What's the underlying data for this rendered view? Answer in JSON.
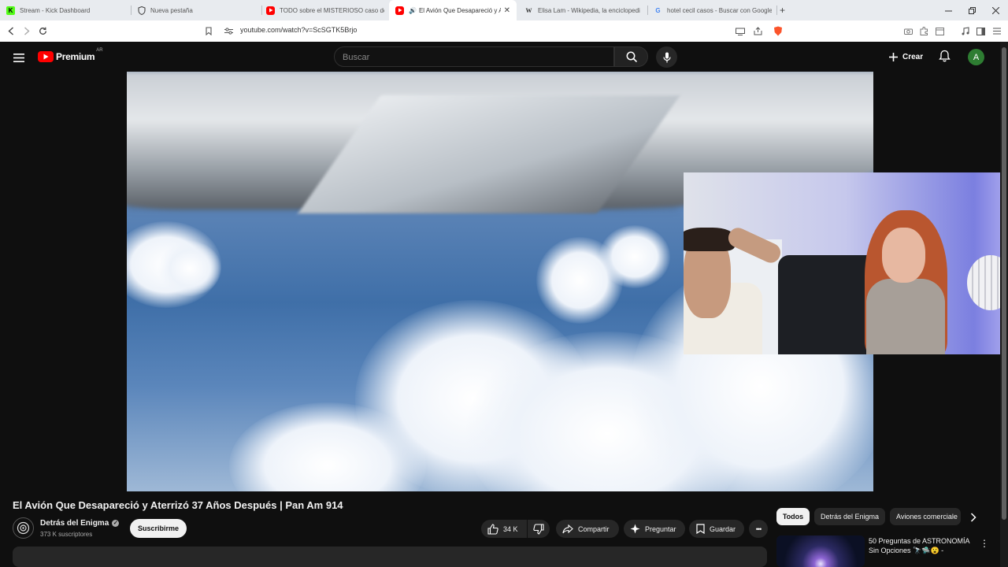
{
  "browser": {
    "tabs": [
      {
        "title": "Stream - Kick Dashboard",
        "icon": "kick-icon",
        "active": false
      },
      {
        "title": "Nueva pestaña",
        "icon": "shield-icon",
        "active": false
      },
      {
        "title": "TODO sobre el MISTERIOSO caso de",
        "icon": "youtube-icon",
        "active": false
      },
      {
        "title": "El Avión Que Desapareció y A",
        "icon": "youtube-icon",
        "active": true
      },
      {
        "title": "Elisa Lam - Wikipedia, la enciclopedi",
        "icon": "wikipedia-icon",
        "active": false
      },
      {
        "title": "hotel cecil casos - Buscar con Google",
        "icon": "google-icon",
        "active": false
      }
    ],
    "new_tab": "+",
    "url": "youtube.com/watch?v=ScSGTK5Brjo"
  },
  "youtube": {
    "logo_text": "Premium",
    "logo_badge": "AR",
    "search_placeholder": "Buscar",
    "create_label": "Crear",
    "avatar_letter": "A"
  },
  "video": {
    "title": "El Avión Que Desapareció y Aterrizó 37 Años Después | Pan Am 914",
    "channel": "Detrás del Enigma",
    "subscribers": "373 K suscriptores",
    "subscribe_label": "Suscribirme",
    "likes": "34 K",
    "share_label": "Compartir",
    "ask_label": "Preguntar",
    "save_label": "Guardar",
    "more_label": "•••"
  },
  "sidebar": {
    "chips": [
      "Todos",
      "Detrás del Enigma",
      "Aviones comerciale"
    ],
    "recommendation_title": "50 Preguntas de ASTRONOMÍA Sin Opciones 🔭🛸😮 -"
  }
}
